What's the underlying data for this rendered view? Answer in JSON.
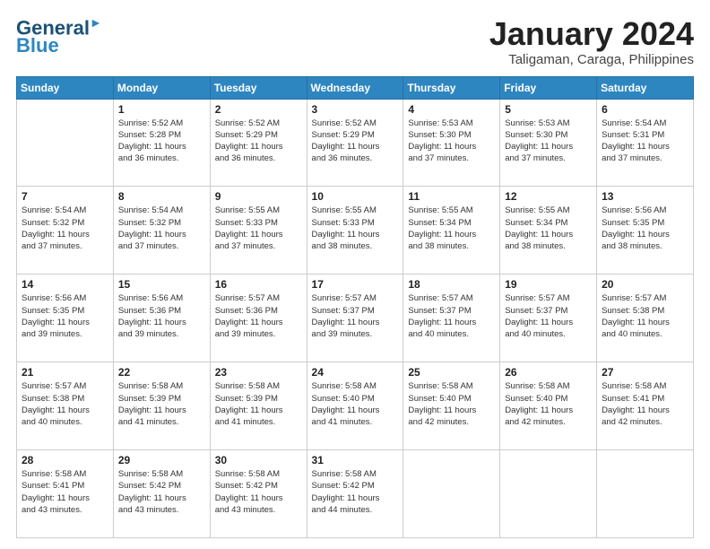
{
  "header": {
    "logo_line1": "General",
    "logo_line2": "Blue",
    "month_title": "January 2024",
    "location": "Taligaman, Caraga, Philippines"
  },
  "weekdays": [
    "Sunday",
    "Monday",
    "Tuesday",
    "Wednesday",
    "Thursday",
    "Friday",
    "Saturday"
  ],
  "weeks": [
    [
      {
        "day": "",
        "detail": ""
      },
      {
        "day": "1",
        "detail": "Sunrise: 5:52 AM\nSunset: 5:28 PM\nDaylight: 11 hours\nand 36 minutes."
      },
      {
        "day": "2",
        "detail": "Sunrise: 5:52 AM\nSunset: 5:29 PM\nDaylight: 11 hours\nand 36 minutes."
      },
      {
        "day": "3",
        "detail": "Sunrise: 5:52 AM\nSunset: 5:29 PM\nDaylight: 11 hours\nand 36 minutes."
      },
      {
        "day": "4",
        "detail": "Sunrise: 5:53 AM\nSunset: 5:30 PM\nDaylight: 11 hours\nand 37 minutes."
      },
      {
        "day": "5",
        "detail": "Sunrise: 5:53 AM\nSunset: 5:30 PM\nDaylight: 11 hours\nand 37 minutes."
      },
      {
        "day": "6",
        "detail": "Sunrise: 5:54 AM\nSunset: 5:31 PM\nDaylight: 11 hours\nand 37 minutes."
      }
    ],
    [
      {
        "day": "7",
        "detail": "Sunrise: 5:54 AM\nSunset: 5:32 PM\nDaylight: 11 hours\nand 37 minutes."
      },
      {
        "day": "8",
        "detail": "Sunrise: 5:54 AM\nSunset: 5:32 PM\nDaylight: 11 hours\nand 37 minutes."
      },
      {
        "day": "9",
        "detail": "Sunrise: 5:55 AM\nSunset: 5:33 PM\nDaylight: 11 hours\nand 37 minutes."
      },
      {
        "day": "10",
        "detail": "Sunrise: 5:55 AM\nSunset: 5:33 PM\nDaylight: 11 hours\nand 38 minutes."
      },
      {
        "day": "11",
        "detail": "Sunrise: 5:55 AM\nSunset: 5:34 PM\nDaylight: 11 hours\nand 38 minutes."
      },
      {
        "day": "12",
        "detail": "Sunrise: 5:55 AM\nSunset: 5:34 PM\nDaylight: 11 hours\nand 38 minutes."
      },
      {
        "day": "13",
        "detail": "Sunrise: 5:56 AM\nSunset: 5:35 PM\nDaylight: 11 hours\nand 38 minutes."
      }
    ],
    [
      {
        "day": "14",
        "detail": "Sunrise: 5:56 AM\nSunset: 5:35 PM\nDaylight: 11 hours\nand 39 minutes."
      },
      {
        "day": "15",
        "detail": "Sunrise: 5:56 AM\nSunset: 5:36 PM\nDaylight: 11 hours\nand 39 minutes."
      },
      {
        "day": "16",
        "detail": "Sunrise: 5:57 AM\nSunset: 5:36 PM\nDaylight: 11 hours\nand 39 minutes."
      },
      {
        "day": "17",
        "detail": "Sunrise: 5:57 AM\nSunset: 5:37 PM\nDaylight: 11 hours\nand 39 minutes."
      },
      {
        "day": "18",
        "detail": "Sunrise: 5:57 AM\nSunset: 5:37 PM\nDaylight: 11 hours\nand 40 minutes."
      },
      {
        "day": "19",
        "detail": "Sunrise: 5:57 AM\nSunset: 5:37 PM\nDaylight: 11 hours\nand 40 minutes."
      },
      {
        "day": "20",
        "detail": "Sunrise: 5:57 AM\nSunset: 5:38 PM\nDaylight: 11 hours\nand 40 minutes."
      }
    ],
    [
      {
        "day": "21",
        "detail": "Sunrise: 5:57 AM\nSunset: 5:38 PM\nDaylight: 11 hours\nand 40 minutes."
      },
      {
        "day": "22",
        "detail": "Sunrise: 5:58 AM\nSunset: 5:39 PM\nDaylight: 11 hours\nand 41 minutes."
      },
      {
        "day": "23",
        "detail": "Sunrise: 5:58 AM\nSunset: 5:39 PM\nDaylight: 11 hours\nand 41 minutes."
      },
      {
        "day": "24",
        "detail": "Sunrise: 5:58 AM\nSunset: 5:40 PM\nDaylight: 11 hours\nand 41 minutes."
      },
      {
        "day": "25",
        "detail": "Sunrise: 5:58 AM\nSunset: 5:40 PM\nDaylight: 11 hours\nand 42 minutes."
      },
      {
        "day": "26",
        "detail": "Sunrise: 5:58 AM\nSunset: 5:40 PM\nDaylight: 11 hours\nand 42 minutes."
      },
      {
        "day": "27",
        "detail": "Sunrise: 5:58 AM\nSunset: 5:41 PM\nDaylight: 11 hours\nand 42 minutes."
      }
    ],
    [
      {
        "day": "28",
        "detail": "Sunrise: 5:58 AM\nSunset: 5:41 PM\nDaylight: 11 hours\nand 43 minutes."
      },
      {
        "day": "29",
        "detail": "Sunrise: 5:58 AM\nSunset: 5:42 PM\nDaylight: 11 hours\nand 43 minutes."
      },
      {
        "day": "30",
        "detail": "Sunrise: 5:58 AM\nSunset: 5:42 PM\nDaylight: 11 hours\nand 43 minutes."
      },
      {
        "day": "31",
        "detail": "Sunrise: 5:58 AM\nSunset: 5:42 PM\nDaylight: 11 hours\nand 44 minutes."
      },
      {
        "day": "",
        "detail": ""
      },
      {
        "day": "",
        "detail": ""
      },
      {
        "day": "",
        "detail": ""
      }
    ]
  ]
}
